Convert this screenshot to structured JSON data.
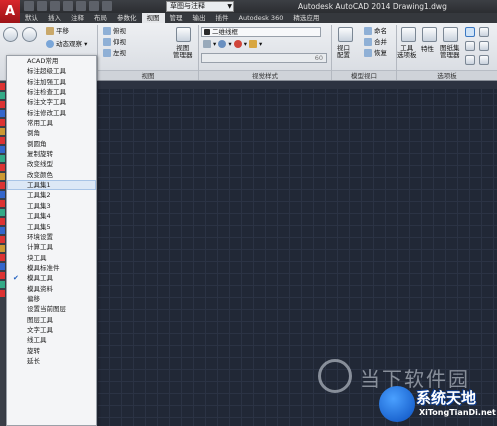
{
  "app": {
    "logo": "A",
    "title": "Autodesk AutoCAD 2014    Drawing1.dwg"
  },
  "workspace": {
    "value": "草图与注释"
  },
  "tabs": [
    "默认",
    "插入",
    "注释",
    "布局",
    "参数化",
    "视图",
    "管理",
    "输出",
    "插件",
    "Autodesk 360",
    "精选应用"
  ],
  "active_tab": "视图",
  "ribbon": {
    "navigate": {
      "pan": "平移",
      "orbit": "动态观察"
    },
    "views": {
      "top": "俯视",
      "bottom": "仰视",
      "left": "左视"
    },
    "view_manager": "视图\n管理器",
    "visual_style": {
      "value": "二维线框"
    },
    "panel_views": "视图",
    "panel_visual_styles": "视觉样式",
    "slider_value": "60",
    "model_viewport": {
      "viewport_config": "视口\n配置",
      "name": "命名",
      "join": "合并",
      "restore": "恢复"
    },
    "panel_model_viewport": "模型视口",
    "palettes": {
      "tool_palettes": "工具\n选项板",
      "properties": "特性",
      "sheet_set": "图纸集\n管理器"
    },
    "panel_palettes": "选项板"
  },
  "menu": {
    "items": [
      {
        "label": "ACAD常用",
        "checked": false
      },
      {
        "label": "标注超级工具",
        "checked": false
      },
      {
        "label": "标注加强工具",
        "checked": false
      },
      {
        "label": "标注检查工具",
        "checked": false
      },
      {
        "label": "标注文字工具",
        "checked": false
      },
      {
        "label": "标注修改工具",
        "checked": false
      },
      {
        "label": "常用工具",
        "checked": false
      },
      {
        "label": "倒角",
        "checked": false
      },
      {
        "label": "倒圆角",
        "checked": false
      },
      {
        "label": "复制旋转",
        "checked": false
      },
      {
        "label": "改变线型",
        "checked": false
      },
      {
        "label": "改变颜色",
        "checked": false
      },
      {
        "label": "工具集1",
        "checked": false,
        "highlight": true
      },
      {
        "label": "工具集2",
        "checked": false
      },
      {
        "label": "工具集3",
        "checked": false
      },
      {
        "label": "工具集4",
        "checked": false
      },
      {
        "label": "工具集5",
        "checked": false
      },
      {
        "label": "环境设置",
        "checked": false
      },
      {
        "label": "计算工具",
        "checked": false
      },
      {
        "label": "块工具",
        "checked": false
      },
      {
        "label": "模具标准件",
        "checked": false
      },
      {
        "label": "模具工具",
        "checked": true
      },
      {
        "label": "模具资料",
        "checked": false
      },
      {
        "label": "偏移",
        "checked": false
      },
      {
        "label": "设置当前图层",
        "checked": false
      },
      {
        "label": "图层工具",
        "checked": false
      },
      {
        "label": "文字工具",
        "checked": false
      },
      {
        "label": "线工具",
        "checked": false
      },
      {
        "label": "旋转",
        "checked": false
      },
      {
        "label": "延长",
        "checked": false
      }
    ]
  },
  "watermarks": {
    "site1": "当下软件园",
    "site2": "系统天地",
    "site2_url": "XiTongTianDi.net"
  },
  "colors": {
    "canvas": "#212836",
    "accent_red": "#c8202a",
    "check": "#1f5fbf"
  }
}
